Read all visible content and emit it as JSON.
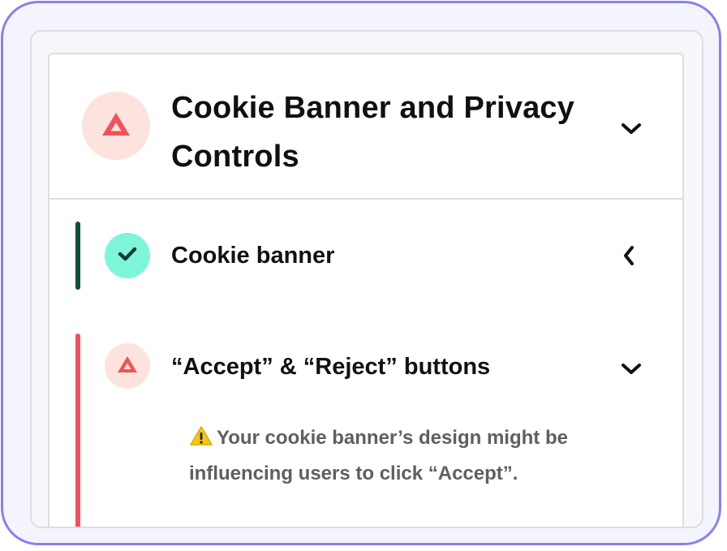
{
  "section": {
    "title": "Cookie Banner and Privacy Controls",
    "status_icon": "warning-triangle-icon",
    "chevron": "chevron-down-icon"
  },
  "checks": [
    {
      "label": "Cookie banner",
      "status": "pass",
      "status_icon": "check-icon",
      "chevron": "chevron-left-icon"
    },
    {
      "label": "“Accept” & “Reject” buttons",
      "status": "fail",
      "status_icon": "warning-triangle-icon",
      "chevron": "chevron-down-icon",
      "message_icon": "warning-emoji-icon",
      "message": "Your cookie banner’s design might be influencing users to click “Accept”."
    }
  ],
  "colors": {
    "frame_border": "#8a7ff0",
    "pass_accent": "#0f4f3c",
    "pass_badge": "#7ef5d8",
    "fail_accent": "#f1525a",
    "fail_badge": "#fde3de",
    "warning_yellow": "#f5c518"
  }
}
